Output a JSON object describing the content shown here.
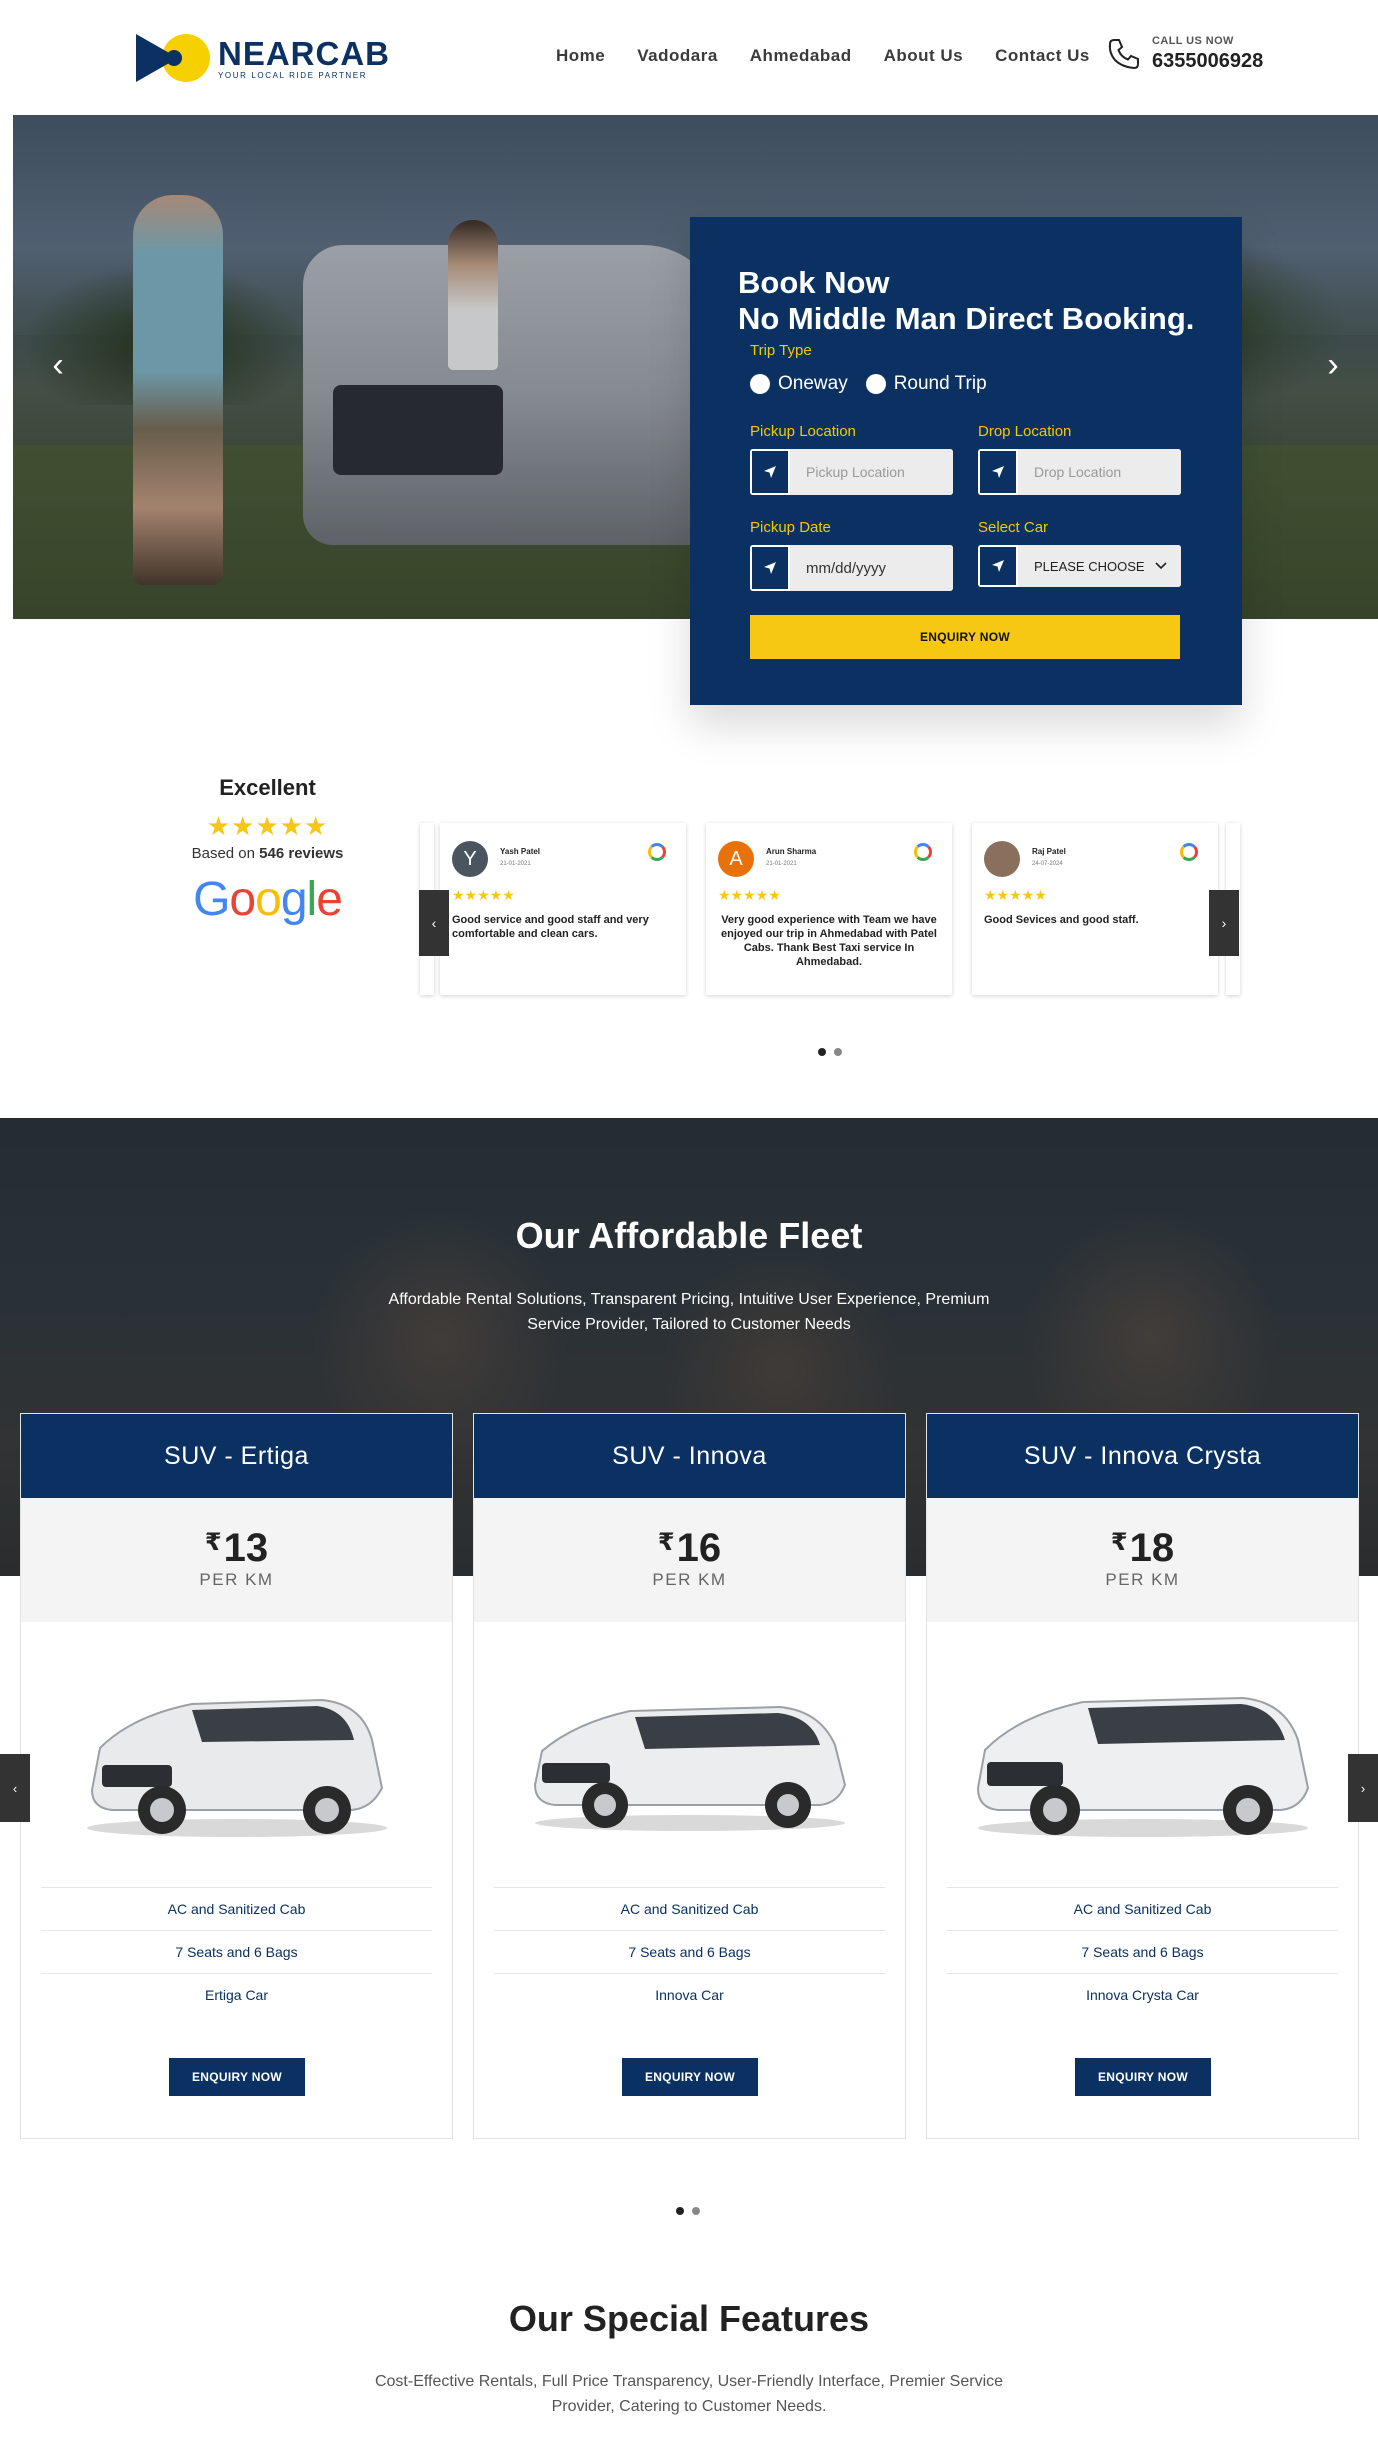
{
  "brand": {
    "name": "NEARCAB",
    "tagline": "YOUR LOCAL RIDE PARTNER",
    "primary_color": "#0a3161",
    "accent_color": "#f6c713"
  },
  "nav": {
    "items": [
      "Home",
      "Vadodara",
      "Ahmedabad",
      "About Us",
      "Contact Us"
    ]
  },
  "call": {
    "label": "CALL US NOW",
    "number": "6355006928"
  },
  "hero": {
    "prev_icon": "chevron-left-icon",
    "next_icon": "chevron-right-icon"
  },
  "booking": {
    "title1": "Book Now",
    "title2": "No Middle Man Direct Booking.",
    "trip_type_label": "Trip Type",
    "trip_options": [
      "Oneway",
      "Round Trip"
    ],
    "pickup_label": "Pickup Location",
    "pickup_placeholder": "Pickup Location",
    "drop_label": "Drop Location",
    "drop_placeholder": "Drop Location",
    "date_label": "Pickup Date",
    "date_value": "mm/dd/yyyy",
    "car_label": "Select Car",
    "car_value": "PLEASE CHOOSE",
    "submit": "ENQUIRY NOW"
  },
  "reviews": {
    "rating_word": "Excellent",
    "stars": "★★★★★",
    "based_prefix": "Based on",
    "count": "546 reviews",
    "provider": "Google",
    "cards": [
      {
        "initial": "Y",
        "name": "Yash Patel",
        "date": "21-01-2021",
        "stars": "★★★★★",
        "text": "Good service and good staff and very comfortable and clean cars.",
        "avatar_color": "#4a5560"
      },
      {
        "initial": "A",
        "name": "Arun Sharma",
        "date": "21-01-2021",
        "stars": "★★★★★",
        "text": "Very good experience with Team we have enjoyed our trip in Ahmedabad with Patel Cabs. Thank Best Taxi service In Ahmedabad.",
        "avatar_color": "#e8710a"
      },
      {
        "initial": "",
        "name": "Raj Patel",
        "date": "24-07-2024",
        "stars": "★★★★★",
        "text": "Good Sevices and good staff.",
        "avatar_color": "#8a6f5c"
      }
    ],
    "prev": "‹",
    "next": "›"
  },
  "fleet": {
    "title": "Our Affordable Fleet",
    "subtitle": "Affordable Rental Solutions, Transparent Pricing, Intuitive User Experience, Premium Service Provider, Tailored to Customer Needs",
    "cars": [
      {
        "name": "SUV - Ertiga",
        "currency": "₹",
        "price": "13",
        "unit": "PER KM",
        "features": [
          "AC and Sanitized Cab",
          "7 Seats and 6 Bags",
          "Ertiga Car"
        ],
        "button": "ENQUIRY NOW"
      },
      {
        "name": "SUV - Innova",
        "currency": "₹",
        "price": "16",
        "unit": "PER KM",
        "features": [
          "AC and Sanitized Cab",
          "7 Seats and 6 Bags",
          "Innova Car"
        ],
        "button": "ENQUIRY NOW"
      },
      {
        "name": "SUV - Innova Crysta",
        "currency": "₹",
        "price": "18",
        "unit": "PER KM",
        "features": [
          "AC and Sanitized Cab",
          "7 Seats and 6 Bags",
          "Innova Crysta Car"
        ],
        "button": "ENQUIRY NOW"
      }
    ],
    "prev": "‹",
    "next": "›"
  },
  "features": {
    "title": "Our Special Features",
    "subtitle": "Cost-Effective Rentals, Full Price Transparency, User-Friendly Interface, Premier Service Provider, Catering to Customer Needs."
  }
}
